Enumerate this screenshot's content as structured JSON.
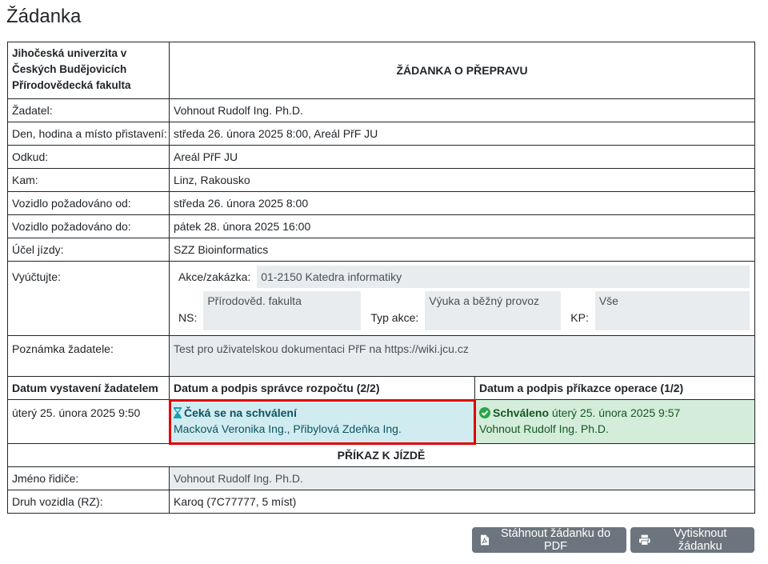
{
  "page": {
    "title": "Žádanka"
  },
  "header": {
    "org_line1": "Jihočeská univerzita v",
    "org_line2": "Českých Budějovicích",
    "org_line3": "Přírodovědecká fakulta",
    "title": "ŽÁDANKA O PŘEPRAVU"
  },
  "rows": {
    "zadatel_label": "Žadatel:",
    "zadatel_value": "Vohnout Rudolf Ing. Ph.D.",
    "pristaveni_label": "Den, hodina a místo přistavení:",
    "pristaveni_value": "středa 26. února 2025 8:00, Areál PřF JU",
    "odkud_label": "Odkud:",
    "odkud_value": "Areál PřF JU",
    "kam_label": "Kam:",
    "kam_value": "Linz, Rakousko",
    "od_label": "Vozidlo požadováno od:",
    "od_value": "středa 26. února 2025 8:00",
    "do_label": "Vozidlo požadováno do:",
    "do_value": "pátek 28. února 2025 16:00",
    "ucel_label": "Účel jízdy:",
    "ucel_value": "SZZ Bioinformatics"
  },
  "billing": {
    "label": "Vyúčtujte:",
    "akce_label": "Akce/zakázka:",
    "akce_value": "01-2150 Katedra informatiky",
    "ns_label": "NS:",
    "ns_value": "Přírodověd. fakulta",
    "typ_label": "Typ akce:",
    "typ_value": "Výuka a běžný provoz",
    "kp_label": "KP:",
    "kp_value": "Vše"
  },
  "note": {
    "label": "Poznámka žadatele:",
    "value": "Test pro uživatelskou dokumentaci PřF na https://wiki.jcu.cz"
  },
  "approvals": {
    "col1_header": "Datum vystavení žadatelem",
    "col2_header": "Datum a podpis správce rozpočtu (2/2)",
    "col3_header": "Datum a podpis příkazce operace (1/2)",
    "issued": "úterý 25. února 2025 9:50",
    "budget_status": "Čeká se na schválení",
    "budget_people": "Macková Veronika Ing., Přibylová Zdeňka Ing.",
    "operation_status": "Schváleno",
    "operation_date": "úterý 25. února 2025 9:57",
    "operation_person": "Vohnout Rudolf Ing. Ph.D."
  },
  "order": {
    "title": "PŘÍKAZ K JÍZDĚ",
    "driver_label": "Jméno řidiče:",
    "driver_value": "Vohnout Rudolf Ing. Ph.D.",
    "vehicle_label": "Druh vozidla (RZ):",
    "vehicle_value": "Karoq (7C77777, 5 míst)"
  },
  "buttons": {
    "pdf_label": "Stáhnout žádanku do PDF",
    "print_label": "Vytisknout žádanku"
  },
  "icons": {
    "pdf": "file-pdf-icon",
    "print": "printer-icon",
    "hourglass": "hourglass-icon",
    "check": "check-circle-icon"
  },
  "colors": {
    "pending_bg": "#d1ecf1",
    "pending_text": "#0c5460",
    "approved_bg": "#d4edda",
    "approved_text": "#155724",
    "highlight": "#e00000",
    "readonly_bg": "#e9ecef",
    "button_bg": "#6c757d"
  }
}
